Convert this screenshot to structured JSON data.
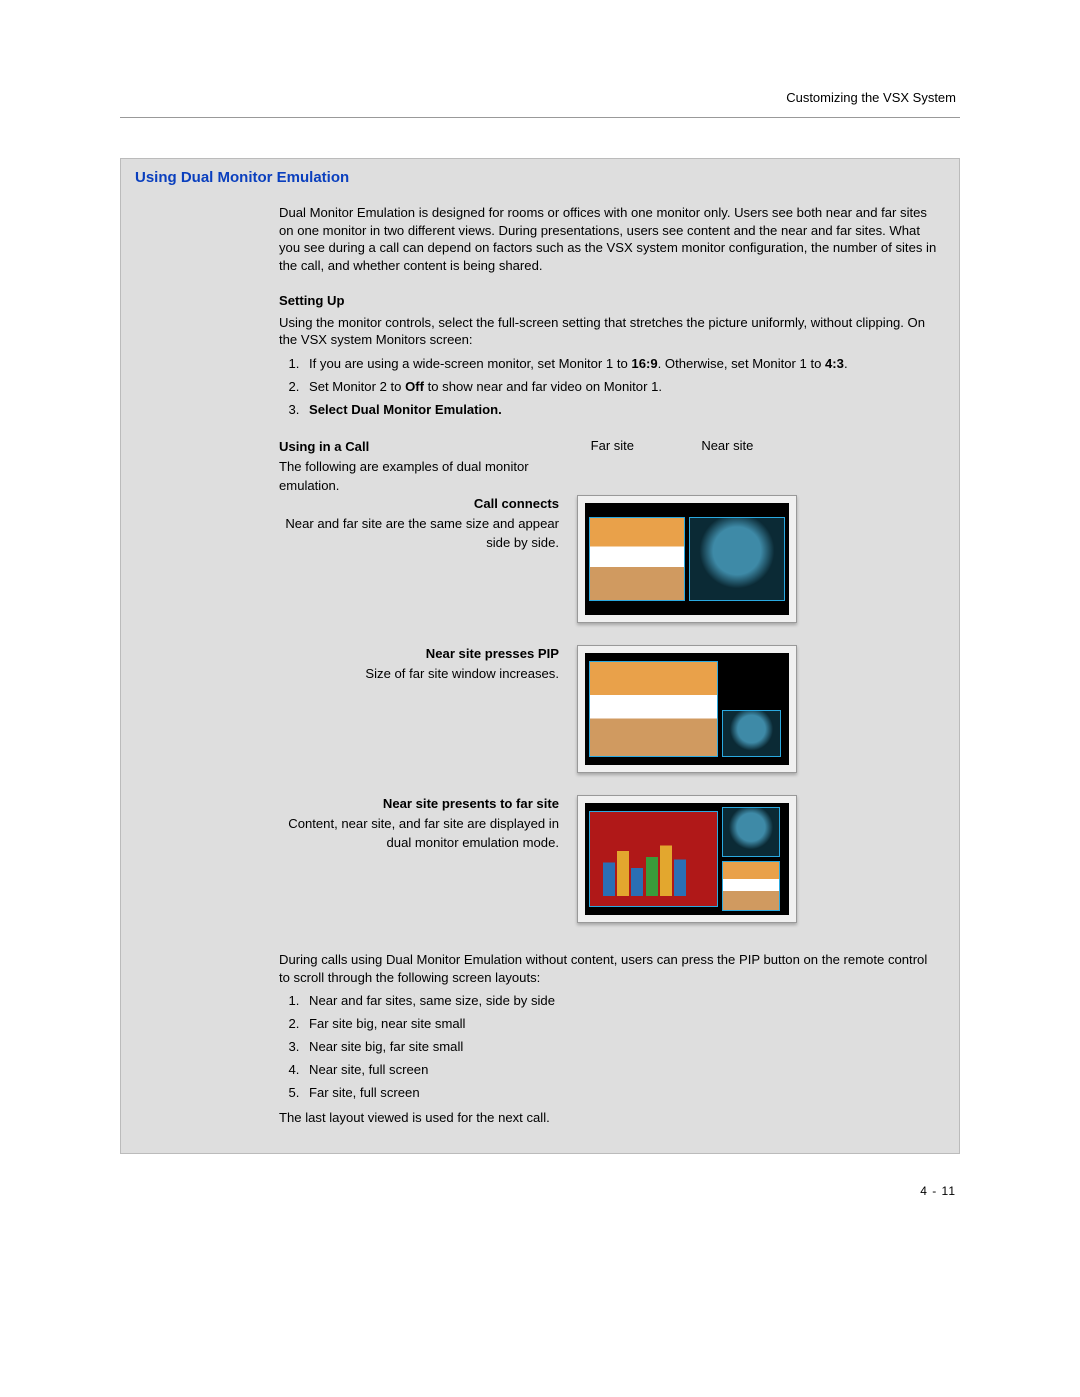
{
  "header": {
    "running": "Customizing the VSX System"
  },
  "panel": {
    "title": "Using Dual Monitor Emulation",
    "intro": "Dual Monitor Emulation is designed for rooms or offices with one monitor only. Users see both near and far sites on one monitor in two different views. During presentations, users see content and the near and far sites. What you see during a call can depend on factors such as the VSX system monitor configuration, the number of sites in the call, and whether content is being shared.",
    "setting_up": {
      "heading": "Setting Up",
      "lead": "Using the monitor controls, select the full-screen setting that stretches the picture uniformly, without clipping. On the VSX system Monitors screen:",
      "steps": [
        "If you are using a wide-screen monitor, set Monitor 1 to 16:9. Otherwise, set Monitor 1 to 4:3.",
        "Set Monitor 2 to Off to show near and far video on Monitor 1.",
        "Select Dual Monitor Emulation."
      ]
    },
    "using": {
      "heading": "Using in a Call",
      "lead": "The following are examples of dual monitor emulation.",
      "far_label": "Far site",
      "near_label": "Near site",
      "ex1": {
        "title": "Call connects",
        "text": "Near and far site are the same size and appear side by side."
      },
      "ex2": {
        "title": "Near site presses PIP",
        "text": "Size of far site window increases."
      },
      "ex3": {
        "title": "Near site presents to far site",
        "text": "Content, near site, and far site are displayed in dual monitor emulation mode."
      }
    },
    "pip_para": "During calls using Dual Monitor Emulation without content, users can press the PIP button on the remote control to scroll through the following screen layouts:",
    "pip_list": [
      "Near and far sites, same size, side by side",
      "Far site big, near site small",
      "Near site big, far site small",
      "Near site, full screen",
      "Far site, full screen"
    ],
    "closing": "The last layout viewed is used for the next call."
  },
  "footer": {
    "pagenum": "4 - 11"
  }
}
